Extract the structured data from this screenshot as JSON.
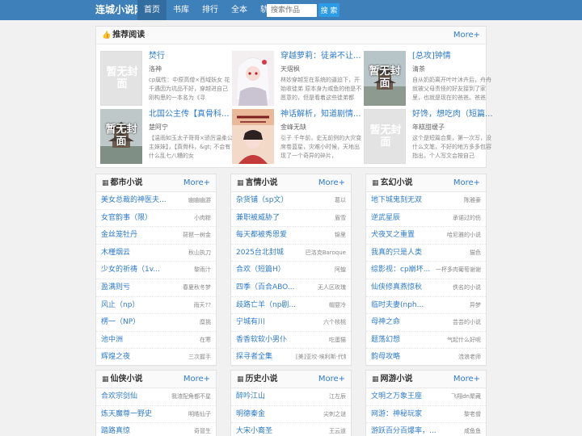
{
  "nav": {
    "brand": "连城小说网",
    "items": [
      "首页",
      "书库",
      "排行",
      "全本",
      "轨迹"
    ],
    "active": 0,
    "search_placeholder": "搜索作品",
    "search_button": "搜 索"
  },
  "recommend": {
    "title": "推荐阅读",
    "more": "More+",
    "placeholder_text": "暂无封面",
    "books": [
      {
        "title": "焚行",
        "author": "洛神",
        "intro": "cp属性：中原高僧×西域妖女 花千遇因为坑品不好，穿越进自己刚构思的一本名为《寻"
      },
      {
        "title": "穿越萝莉：徒弟不让...",
        "author": "天熠枫",
        "intro": "林妙穿越至在系统的逼迫下，开始收徒弟 原本身为咸鱼的他是不愿意的，但是看着这些徒弟都"
      },
      {
        "title": "[总攻]钟情",
        "author": "清茶",
        "intro": "自从奶奶离开叶叶沐卉后，舟舟就被父母责怪的好友接到了家里，也就是现在的爸爸。爸爸"
      },
      {
        "title": "北国公主传【真骨科...",
        "author": "楚阿宁",
        "intro": "【温雨如玉太子哥哥×骄厉温柔公主妹妹】，【真骨科，&gt; 不会有什么乱七八糟的女"
      },
      {
        "title": "神话解析，知道剧情...",
        "author": "金峰无缺",
        "intro": "引子 千年前，史无前例的大灾变席卷蓝星，灾难小时候，天地出现了一个奇异的碎片，"
      },
      {
        "title": "好馋，想吃肉（短篇...",
        "author": "年糕甜缓子",
        "intro": "这个是短篇合集，第一次写，没什么文笔，不好的地方多多包容指出，个人写文会按自己"
      }
    ]
  },
  "sections": [
    {
      "title": "都市小说",
      "more": "More+",
      "items": [
        {
          "t": "美女总裁的神医夫...",
          "a": "幽幽幽游"
        },
        {
          "t": "女官韵事（限）",
          "a": "小肉粽"
        },
        {
          "t": "金丝笼牡丹",
          "a": "琵琶一树金"
        },
        {
          "t": "木槿烟云",
          "a": "秋山执刀"
        },
        {
          "t": "少女的祈祷（1v...",
          "a": "黎雨汁"
        },
        {
          "t": "盈满则亏",
          "a": "春夏秋冬梦"
        },
        {
          "t": "风止（np）",
          "a": "雨天??"
        },
        {
          "t": "楞一（NP）",
          "a": "糜挑"
        },
        {
          "t": "池中洲",
          "a": "在寒"
        },
        {
          "t": "辉煌之夜",
          "a": "三次握手"
        }
      ]
    },
    {
      "title": "言情小说",
      "more": "More+",
      "items": [
        {
          "t": "杂货铺（sp文）",
          "a": "葛以"
        },
        {
          "t": "兼职被威胁了",
          "a": "眉雪"
        },
        {
          "t": "每天都被秀恩爱",
          "a": "锦里"
        },
        {
          "t": "2025台北封城",
          "a": "巴洛克Baroque"
        },
        {
          "t": "合欢（短篇H）",
          "a": "阿蝗"
        },
        {
          "t": "四季（百合ABO...",
          "a": "无人区玫瑰"
        },
        {
          "t": "歧路亡羊（np剧...",
          "a": "帽婴冷"
        },
        {
          "t": "宁城有川",
          "a": "六个核桃"
        },
        {
          "t": "香香软软小男仆",
          "a": "吃蛋猫"
        },
        {
          "t": "探寻者全集",
          "a": "[美]亚坎·埃利斯·代顿"
        }
      ]
    },
    {
      "title": "玄幻小说",
      "more": "More+",
      "items": [
        {
          "t": "地下城鬼刻无双",
          "a": "陈雅豪"
        },
        {
          "t": "逆武星辰",
          "a": "承诺过的伤"
        },
        {
          "t": "犬夜叉之重置",
          "a": "哈尼雅的小说"
        },
        {
          "t": "我真的只是人类",
          "a": "猫色"
        },
        {
          "t": "综影视：cp崩坏...",
          "a": "一杯多肉葡萄谢谢"
        },
        {
          "t": "仙侠修真燕惊秋",
          "a": "佚名的小说"
        },
        {
          "t": "临时夫妻(nph...",
          "a": "异梦"
        },
        {
          "t": "母神之命",
          "a": "芸芸的小说"
        },
        {
          "t": "题荡幻想",
          "a": "气起什么好呢"
        },
        {
          "t": "韵母攻略",
          "a": "流浪老师"
        }
      ]
    },
    {
      "title": "仙侠小说",
      "more": "More+",
      "items": [
        {
          "t": "合欢宗剑仙",
          "a": "我渣配角都不星"
        },
        {
          "t": "炼天魔尊一野史",
          "a": "明皓仙子"
        },
        {
          "t": "踏路真惊",
          "a": "奇冒生"
        }
      ]
    },
    {
      "title": "历史小说",
      "more": "More+",
      "items": [
        {
          "t": "醉吟江山",
          "a": "江左辰"
        },
        {
          "t": "明德秦金",
          "a": "尖刺之谜"
        },
        {
          "t": "大宋小裔圣",
          "a": "王云道"
        }
      ]
    },
    {
      "title": "网游小说",
      "more": "More+",
      "items": [
        {
          "t": "文明之万象王座",
          "a": "飞翔dn聚藏"
        },
        {
          "t": "网游：神秘玩家",
          "a": "黎老僧"
        },
        {
          "t": "游跃百分百爆率，...",
          "a": "咸鱼鱼"
        }
      ]
    }
  ]
}
